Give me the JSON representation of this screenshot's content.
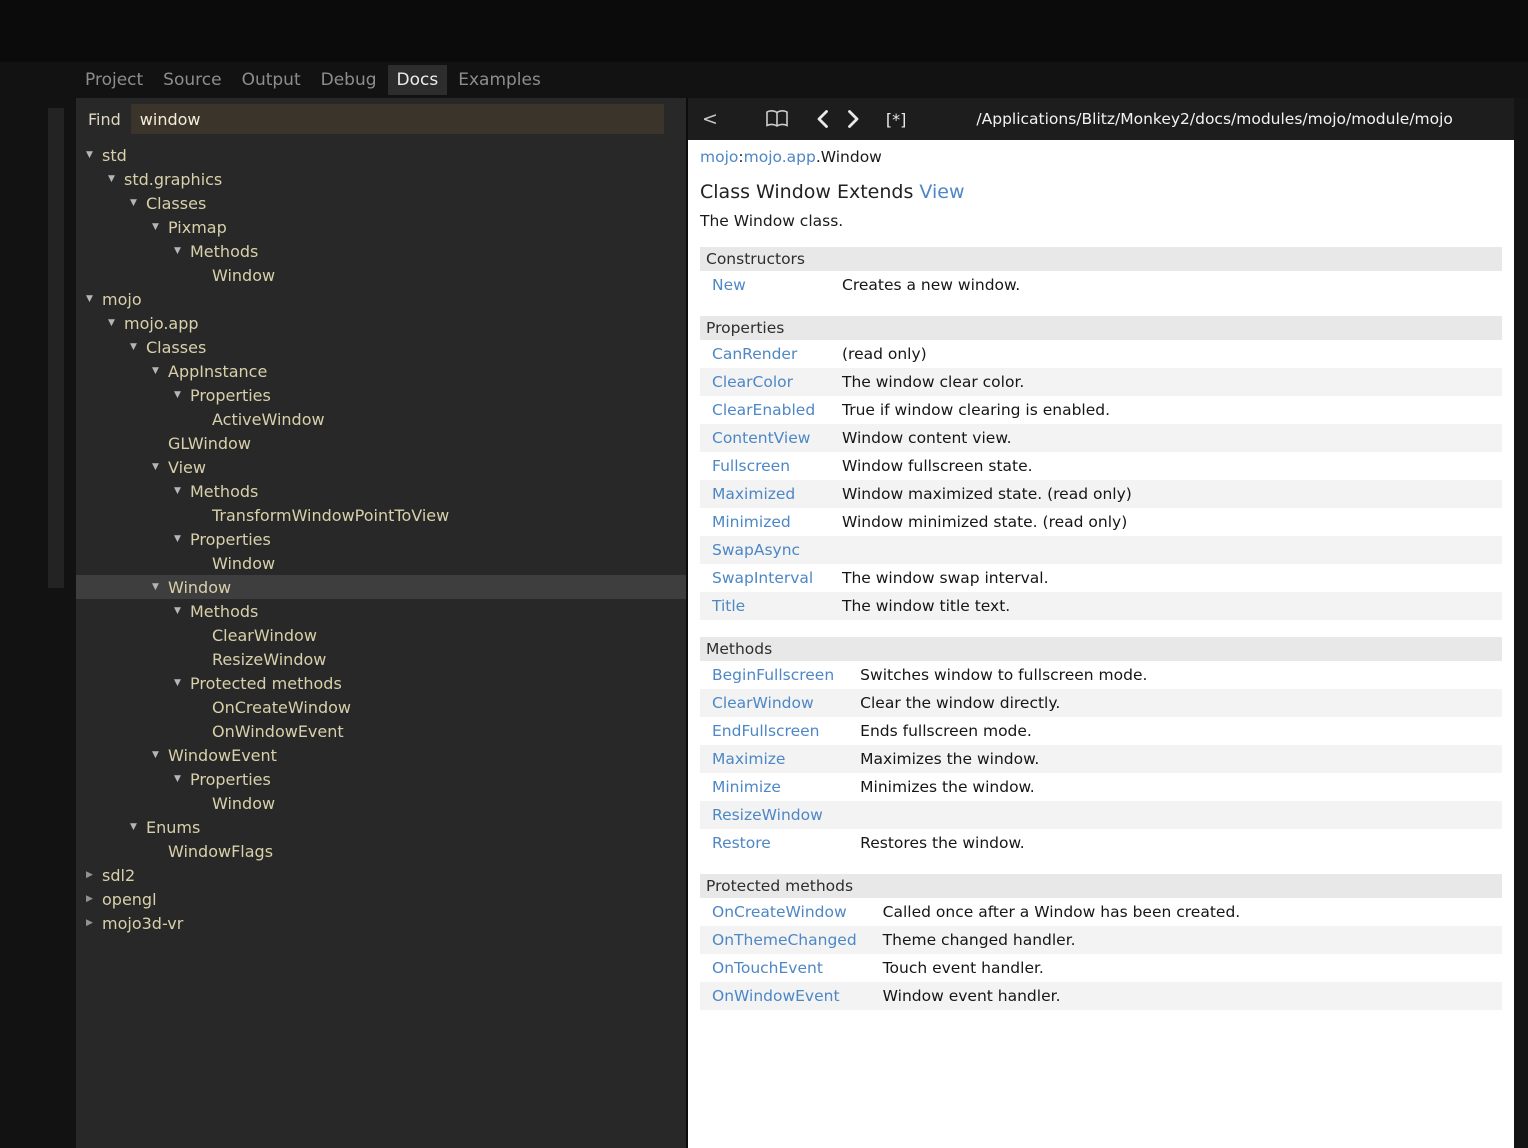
{
  "tabs": [
    {
      "label": "Project",
      "active": false
    },
    {
      "label": "Source",
      "active": false
    },
    {
      "label": "Output",
      "active": false
    },
    {
      "label": "Debug",
      "active": false
    },
    {
      "label": "Docs",
      "active": true
    },
    {
      "label": "Examples",
      "active": false
    }
  ],
  "find": {
    "label": "Find",
    "value": "window"
  },
  "tree": [
    {
      "label": "std",
      "level": 0,
      "arrow": "down"
    },
    {
      "label": "std.graphics",
      "level": 1,
      "arrow": "down"
    },
    {
      "label": "Classes",
      "level": 2,
      "arrow": "down"
    },
    {
      "label": "Pixmap",
      "level": 3,
      "arrow": "down"
    },
    {
      "label": "Methods",
      "level": 4,
      "arrow": "down"
    },
    {
      "label": "Window",
      "level": 5,
      "arrow": "none"
    },
    {
      "label": "mojo",
      "level": 0,
      "arrow": "down"
    },
    {
      "label": "mojo.app",
      "level": 1,
      "arrow": "down"
    },
    {
      "label": "Classes",
      "level": 2,
      "arrow": "down"
    },
    {
      "label": "AppInstance",
      "level": 3,
      "arrow": "down"
    },
    {
      "label": "Properties",
      "level": 4,
      "arrow": "down"
    },
    {
      "label": "ActiveWindow",
      "level": 5,
      "arrow": "none"
    },
    {
      "label": "GLWindow",
      "level": 3,
      "arrow": "none"
    },
    {
      "label": "View",
      "level": 3,
      "arrow": "down"
    },
    {
      "label": "Methods",
      "level": 4,
      "arrow": "down"
    },
    {
      "label": "TransformWindowPointToView",
      "level": 5,
      "arrow": "none"
    },
    {
      "label": "Properties",
      "level": 4,
      "arrow": "down"
    },
    {
      "label": "Window",
      "level": 5,
      "arrow": "none"
    },
    {
      "label": "Window",
      "level": 3,
      "arrow": "down",
      "selected": true
    },
    {
      "label": "Methods",
      "level": 4,
      "arrow": "down"
    },
    {
      "label": "ClearWindow",
      "level": 5,
      "arrow": "none"
    },
    {
      "label": "ResizeWindow",
      "level": 5,
      "arrow": "none"
    },
    {
      "label": "Protected methods",
      "level": 4,
      "arrow": "down"
    },
    {
      "label": "OnCreateWindow",
      "level": 5,
      "arrow": "none"
    },
    {
      "label": "OnWindowEvent",
      "level": 5,
      "arrow": "none"
    },
    {
      "label": "WindowEvent",
      "level": 3,
      "arrow": "down"
    },
    {
      "label": "Properties",
      "level": 4,
      "arrow": "down"
    },
    {
      "label": "Window",
      "level": 5,
      "arrow": "none"
    },
    {
      "label": "Enums",
      "level": 2,
      "arrow": "down"
    },
    {
      "label": "WindowFlags",
      "level": 3,
      "arrow": "none"
    },
    {
      "label": "sdl2",
      "level": 0,
      "arrow": "right"
    },
    {
      "label": "opengl",
      "level": 0,
      "arrow": "right"
    },
    {
      "label": "mojo3d-vr",
      "level": 0,
      "arrow": "right"
    }
  ],
  "toolbar": {
    "back": "<",
    "home_icon": "open-book-icon",
    "prev_icon": "chevron-left-icon",
    "next_icon": "chevron-right-icon",
    "star": "[*]",
    "path": "/Applications/Blitz/Monkey2/docs/modules/mojo/module/mojo"
  },
  "doc": {
    "breadcrumb": [
      {
        "text": "mojo",
        "link": true
      },
      {
        "text": ":",
        "link": false
      },
      {
        "text": "mojo.app",
        "link": true
      },
      {
        "text": ".Window",
        "link": false
      }
    ],
    "title": {
      "prefix": "Class Window Extends ",
      "link": "View"
    },
    "description": "The Window class.",
    "sections": [
      {
        "heading": "Constructors",
        "rows": [
          {
            "name": "New",
            "desc": "Creates a new window."
          }
        ]
      },
      {
        "heading": "Properties",
        "rows": [
          {
            "name": "CanRender",
            "desc": "(read only)"
          },
          {
            "name": "ClearColor",
            "desc": "The window clear color."
          },
          {
            "name": "ClearEnabled",
            "desc": "True if window clearing is enabled."
          },
          {
            "name": "ContentView",
            "desc": "Window content view."
          },
          {
            "name": "Fullscreen",
            "desc": "Window fullscreen state."
          },
          {
            "name": "Maximized",
            "desc": "Window maximized state. (read only)"
          },
          {
            "name": "Minimized",
            "desc": "Window minimized state. (read only)"
          },
          {
            "name": "SwapAsync",
            "desc": ""
          },
          {
            "name": "SwapInterval",
            "desc": "The window swap interval."
          },
          {
            "name": "Title",
            "desc": "The window title text."
          }
        ]
      },
      {
        "heading": "Methods",
        "rows": [
          {
            "name": "BeginFullscreen",
            "desc": "Switches window to fullscreen mode."
          },
          {
            "name": "ClearWindow",
            "desc": "Clear the window directly."
          },
          {
            "name": "EndFullscreen",
            "desc": "Ends fullscreen mode."
          },
          {
            "name": "Maximize",
            "desc": "Maximizes the window."
          },
          {
            "name": "Minimize",
            "desc": "Minimizes the window."
          },
          {
            "name": "ResizeWindow",
            "desc": ""
          },
          {
            "name": "Restore",
            "desc": "Restores the window."
          }
        ]
      },
      {
        "heading": "Protected methods",
        "rows": [
          {
            "name": "OnCreateWindow",
            "desc": "Called once after a Window has been created."
          },
          {
            "name": "OnThemeChanged",
            "desc": "Theme changed handler."
          },
          {
            "name": "OnTouchEvent",
            "desc": "Touch event handler."
          },
          {
            "name": "OnWindowEvent",
            "desc": "Window event handler."
          }
        ]
      }
    ]
  },
  "colors": {
    "accent_link": "#4d87c6",
    "tree_text": "#d8d0aa",
    "selection_bg": "#3e3e3e",
    "panel_bg": "#282828",
    "doc_bg": "#ffffff",
    "heading_band_bg": "#e8e8e8",
    "row_stripe_bg": "#f3f3f3"
  }
}
